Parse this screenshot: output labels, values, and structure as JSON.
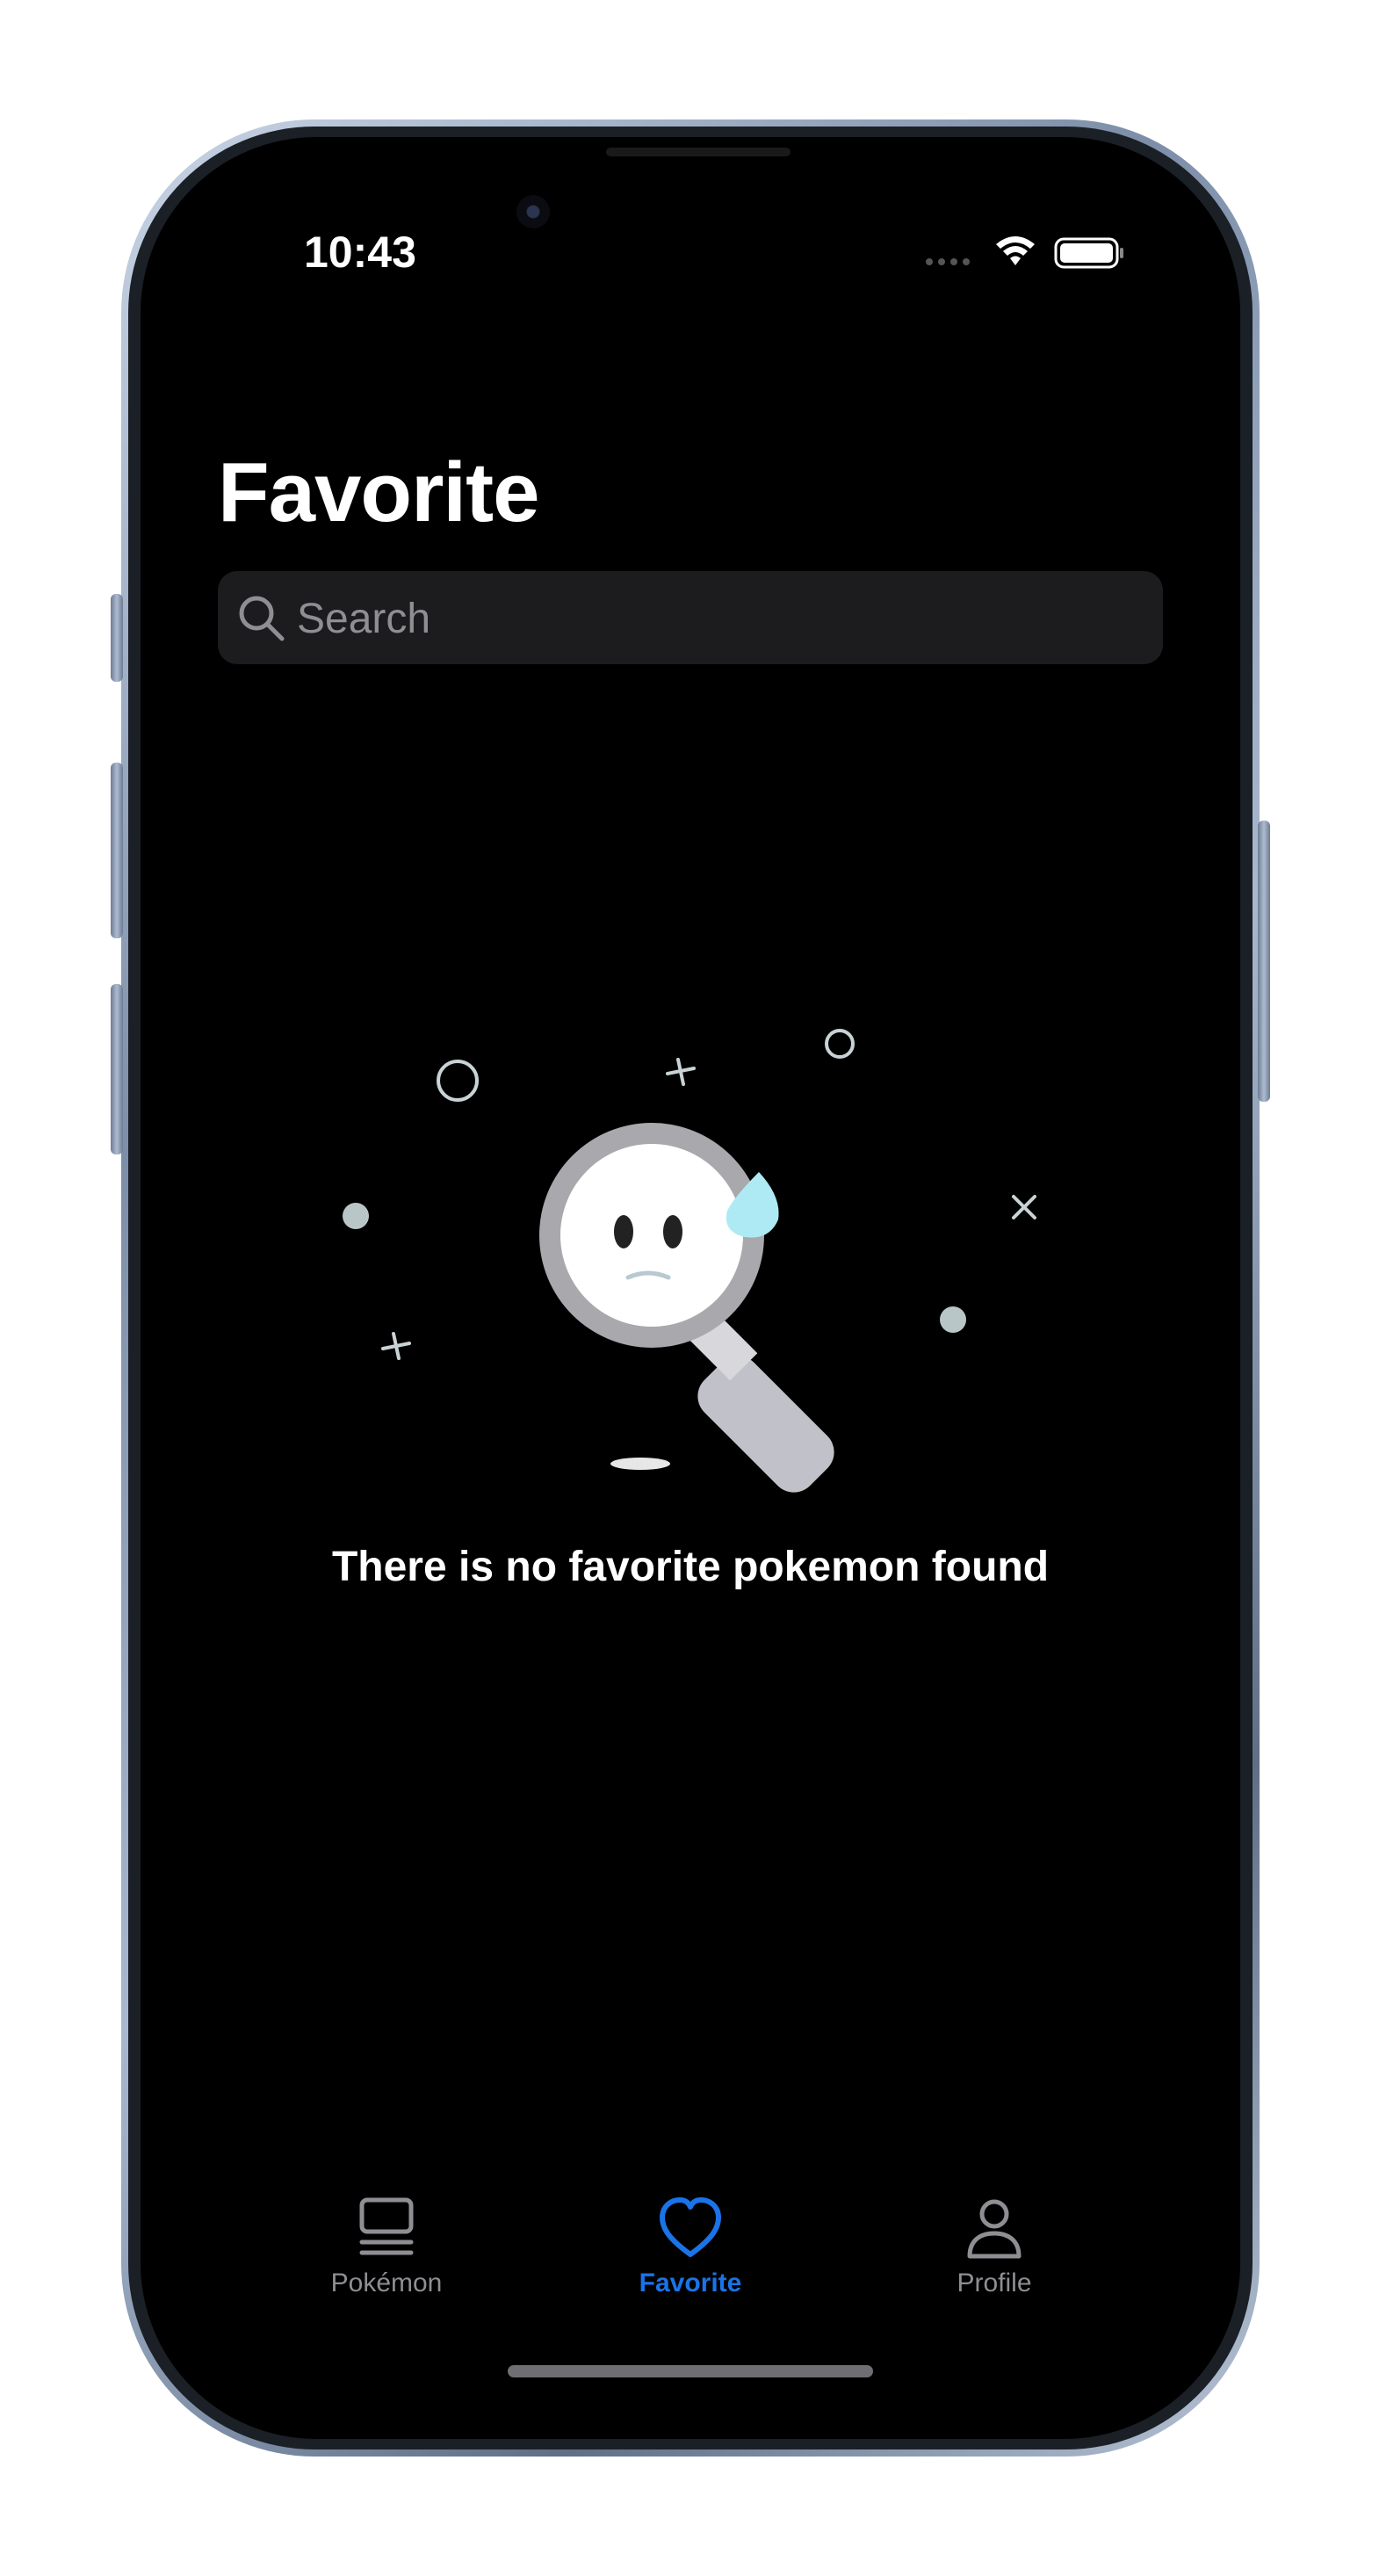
{
  "status_bar": {
    "time": "10:43"
  },
  "header": {
    "title": "Favorite"
  },
  "search": {
    "placeholder": "Search",
    "value": ""
  },
  "empty_state": {
    "message": "There is no favorite pokemon found"
  },
  "tabbar": {
    "items": [
      {
        "label": "Pokémon",
        "icon": "list-icon",
        "selected": false
      },
      {
        "label": "Favorite",
        "icon": "heart-icon",
        "selected": true
      },
      {
        "label": "Profile",
        "icon": "person-icon",
        "selected": false
      }
    ]
  },
  "colors": {
    "accent": "#1a73e8",
    "inactive": "#8e8e93",
    "background": "#000000"
  }
}
